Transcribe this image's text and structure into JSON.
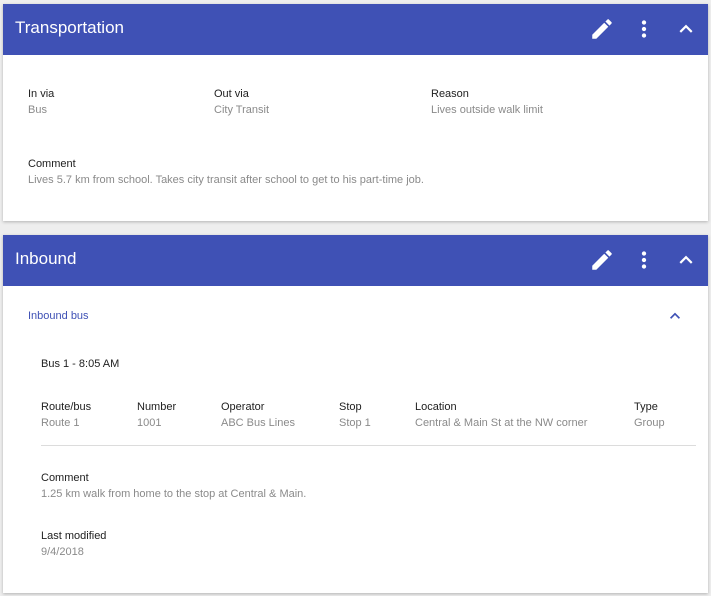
{
  "transportation": {
    "title": "Transportation",
    "fields": [
      {
        "label": "In via",
        "value": "Bus"
      },
      {
        "label": "Out via",
        "value": "City Transit"
      },
      {
        "label": "Reason",
        "value": "Lives outside walk limit"
      }
    ],
    "comment": {
      "label": "Comment",
      "value": "Lives 5.7 km from school. Takes city transit after school to get to his part-time job."
    }
  },
  "inbound": {
    "title": "Inbound",
    "section_label": "Inbound bus",
    "bus_title": "Bus 1 - 8:05 AM",
    "columns": [
      {
        "label": "Route/bus",
        "value": "Route 1"
      },
      {
        "label": "Number",
        "value": "1001"
      },
      {
        "label": "Operator",
        "value": "ABC Bus Lines"
      },
      {
        "label": "Stop",
        "value": "Stop 1"
      },
      {
        "label": "Location",
        "value": "Central & Main St at the NW corner"
      },
      {
        "label": "Type",
        "value": "Group"
      }
    ],
    "comment": {
      "label": "Comment",
      "value": "1.25 km walk from home to the stop at Central & Main."
    },
    "last_modified": {
      "label": "Last modified",
      "value": "9/4/2018"
    }
  },
  "icons": {
    "edit": "pencil-icon",
    "more": "more-vert-icon",
    "collapse": "chevron-up-icon"
  },
  "colors": {
    "header": "#3f51b5",
    "link": "#3f51b5"
  }
}
